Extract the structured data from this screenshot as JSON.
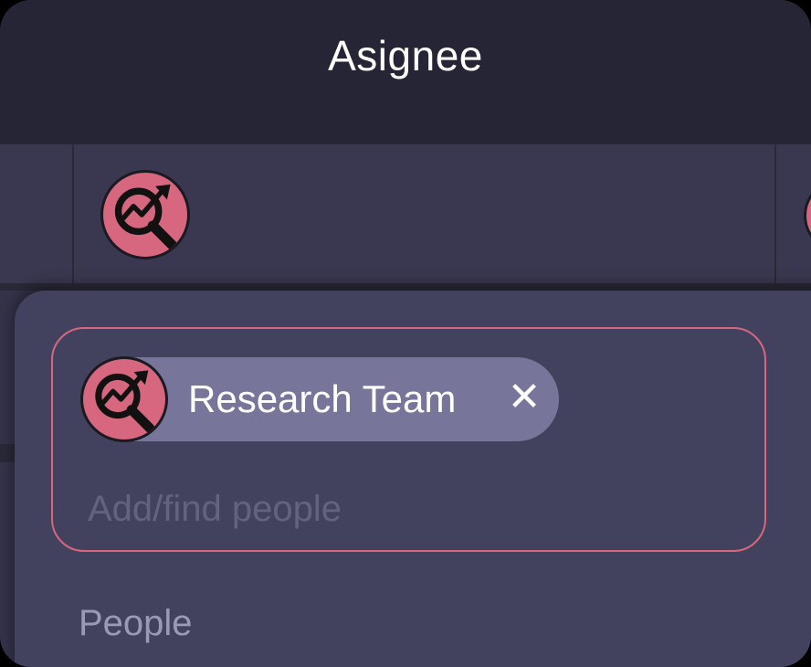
{
  "column": {
    "header_label": "Asignee"
  },
  "assignee_cell": {
    "avatar_icon": "research-analytics-icon"
  },
  "picker": {
    "selected": [
      {
        "label": "Research Team",
        "avatar_icon": "research-analytics-icon",
        "remove_icon": "close-icon",
        "remove_glyph": "✕"
      }
    ],
    "search_placeholder": "Add/find people",
    "section_label": "People"
  },
  "colors": {
    "accent": "#d6677f",
    "popover_bg": "#43425e",
    "chip_bg": "#77769a",
    "header_bg": "#262536",
    "row_bg": "#3a3850"
  }
}
